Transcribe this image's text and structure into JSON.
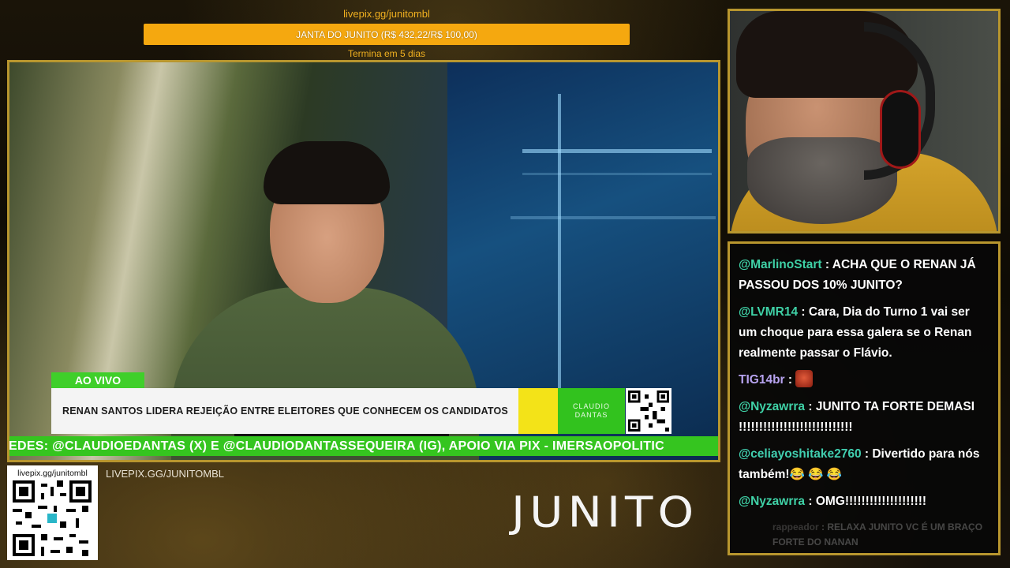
{
  "donation_goal": {
    "url": "livepix.gg/junitombl",
    "label": "JANTA DO JUNITO (R$ 432,22/R$ 100,00)",
    "progress_fraction": 1.0,
    "subtitle": "Termina em 5 dias",
    "colors": {
      "fill": "#f5a80f",
      "text_accent": "#f0b020"
    }
  },
  "broadcast": {
    "live_tag": "AO VIVO",
    "headline": "RENAN SANTOS LIDERA REJEIÇÃO ENTRE ELEITORES QUE CONHECEM OS CANDIDATOS",
    "logo_line1": "CLAUDIO",
    "logo_line2": "DANTAS",
    "ticker": "EDES: @CLAUDIOEDANTAS (X) E @CLAUDIODANTASSEQUEIRA (IG), APOIO VIA PIX - IMERSAOPOLITIC",
    "colors": {
      "green": "#35c51f",
      "yellow": "#f3e318"
    }
  },
  "chat": {
    "messages": [
      {
        "user": "@MarlinoStart",
        "text": "ACHA QUE O RENAN JÁ PASSOU DOS 10% JUNITO?"
      },
      {
        "user": "@LVMR14",
        "text": "Cara, Dia do Turno 1 vai ser um choque para essa galera se o Renan realmente passar o Flávio."
      },
      {
        "user": "TIG14br",
        "text": "",
        "emote": "emote-face-icon"
      },
      {
        "user": "@Nyzawrra",
        "text": "JUNITO TA FORTE DEMASI !!!!!!!!!!!!!!!!!!!!!!!!!!!!"
      },
      {
        "user": "@celiayoshitake2760",
        "text": "Divertido para nós também!😂 😂 😂"
      },
      {
        "user": "@Nyzawrra",
        "text": "OMG!!!!!!!!!!!!!!!!!!!!"
      }
    ],
    "faded_message": {
      "user": "rappeador",
      "text": "RELAXA JUNITO VC É UM BRAÇO FORTE DO NANAN"
    }
  },
  "footer": {
    "qr_label": "livepix.gg/junitombl",
    "url": "LIVEPIX.GG/JUNITOMBL",
    "brand": "JUNITO"
  }
}
